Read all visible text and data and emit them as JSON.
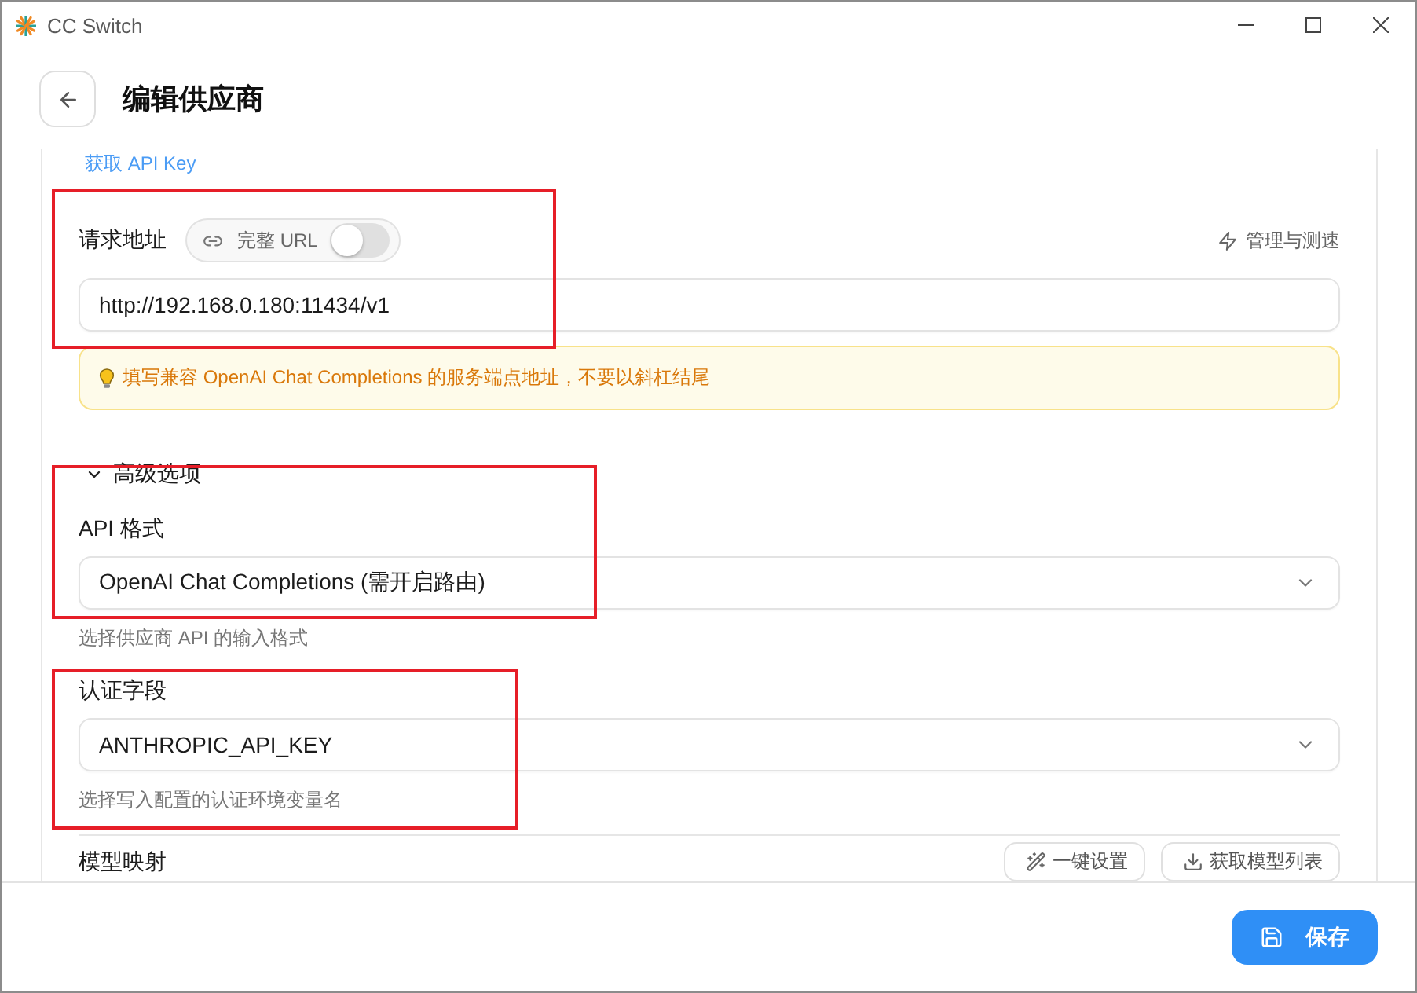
{
  "window": {
    "title": "CC Switch"
  },
  "header": {
    "title": "编辑供应商"
  },
  "api_key_link": "获取 API Key",
  "endpoint": {
    "label": "请求地址",
    "full_url_toggle": {
      "label": "完整 URL",
      "on": false
    },
    "manage_link": "管理与测速",
    "value": "http://192.168.0.180:11434/v1",
    "highlighted": true
  },
  "tip": "填写兼容 OpenAI Chat Completions 的服务端点地址，不要以斜杠结尾",
  "advanced": {
    "label": "高级选项",
    "expanded": true
  },
  "fields": [
    {
      "label": "API 格式",
      "value": "OpenAI Chat Completions (需开启路由)",
      "hint": "选择供应商 API 的输入格式",
      "highlighted": true
    },
    {
      "label": "认证字段",
      "value": "ANTHROPIC_API_KEY",
      "hint": "选择写入配置的认证环境变量名",
      "highlighted": true
    }
  ],
  "model_mapping": {
    "label": "模型映射",
    "buttons": [
      {
        "kind": "wand",
        "label": "一键设置"
      },
      {
        "kind": "download",
        "label": "获取模型列表"
      }
    ]
  },
  "footer": {
    "save_button": "保存"
  }
}
